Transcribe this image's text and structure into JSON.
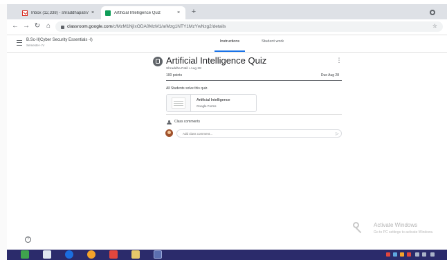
{
  "browser": {
    "tabs": [
      {
        "title": "Inbox (12,338) - shraddhapatil7",
        "icon": "gmail-icon"
      },
      {
        "title": "Artificial Intelligence Quiz",
        "icon": "classroom-icon",
        "active": true
      }
    ],
    "new_tab_label": "+",
    "address": {
      "host": "classroom.google.com",
      "path": "/c/MzM1NjIxODA0MzM1/a/Mzg1NTY1MzYwNzg2/details"
    }
  },
  "classroom": {
    "class_name": "B.Sc-II(Cyber Security Essentials -I)",
    "class_section": "Semester- IV",
    "tabs": [
      "Instructions",
      "Student work"
    ]
  },
  "assignment": {
    "title": "Artificial Intelligence Quiz",
    "meta": "Shraddha Patil • Aug 28",
    "points": "100 points",
    "due": "Due Aug 28",
    "instructions": "All Students solve this quiz.",
    "attachment": {
      "title": "Artificial Intelligence",
      "type": "Google Forms"
    },
    "comments_label": "Class comments",
    "comment_placeholder": "Add class comment..."
  },
  "activation": {
    "title": "Activate Windows",
    "subtitle": "Go to PC settings to activate Windows."
  },
  "colors": {
    "accent": "#1a73e8",
    "taskbar": "#2b2b6b",
    "classroom_green": "#0f9d58"
  },
  "taskbar_icons": [
    "file-manager-icon",
    "monitor-icon",
    "internet-explorer-icon",
    "browser-icon",
    "media-icon",
    "folder-icon",
    "app-icon"
  ]
}
